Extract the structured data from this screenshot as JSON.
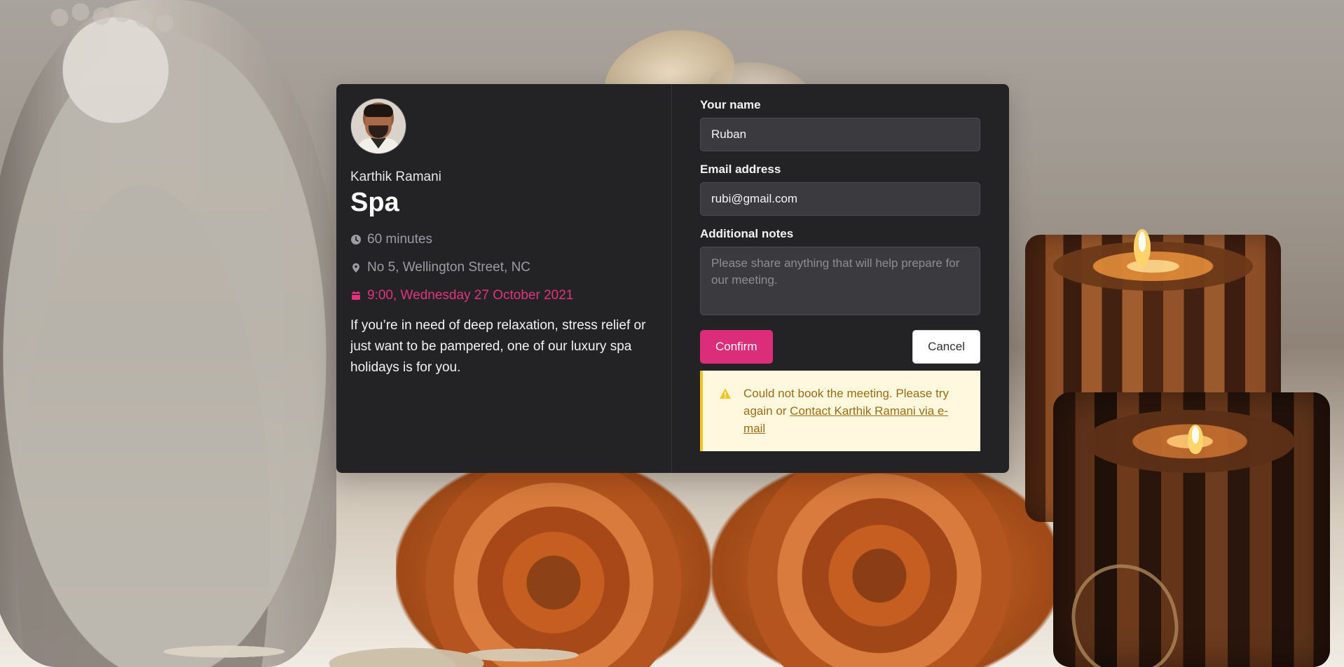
{
  "host": {
    "name": "Karthik Ramani"
  },
  "event": {
    "title": "Spa",
    "duration": "60 minutes",
    "location": "No 5, Wellington Street, NC",
    "datetime": "9:00, Wednesday 27 October 2021",
    "description": "If you’re in need of deep relaxation, stress relief or just want to be pampered, one of our luxury spa holidays is for you."
  },
  "form": {
    "name_label": "Your name",
    "name_value": "Ruban",
    "email_label": "Email address",
    "email_value": "rubi@gmail.com",
    "notes_label": "Additional notes",
    "notes_placeholder": "Please share anything that will help prepare for our meeting.",
    "confirm_label": "Confirm",
    "cancel_label": "Cancel"
  },
  "alert": {
    "text": "Could not book the meeting. Please try again or ",
    "link_text": "Contact Karthik Ramani via e-mail"
  },
  "colors": {
    "accent": "#db2d79",
    "warning": "#f4c51d",
    "card_bg": "#232326",
    "input_bg": "#3a3a3f"
  },
  "icons": {
    "clock": "clock-icon",
    "location": "location-pin-icon",
    "calendar": "calendar-icon",
    "warning": "warning-icon"
  }
}
